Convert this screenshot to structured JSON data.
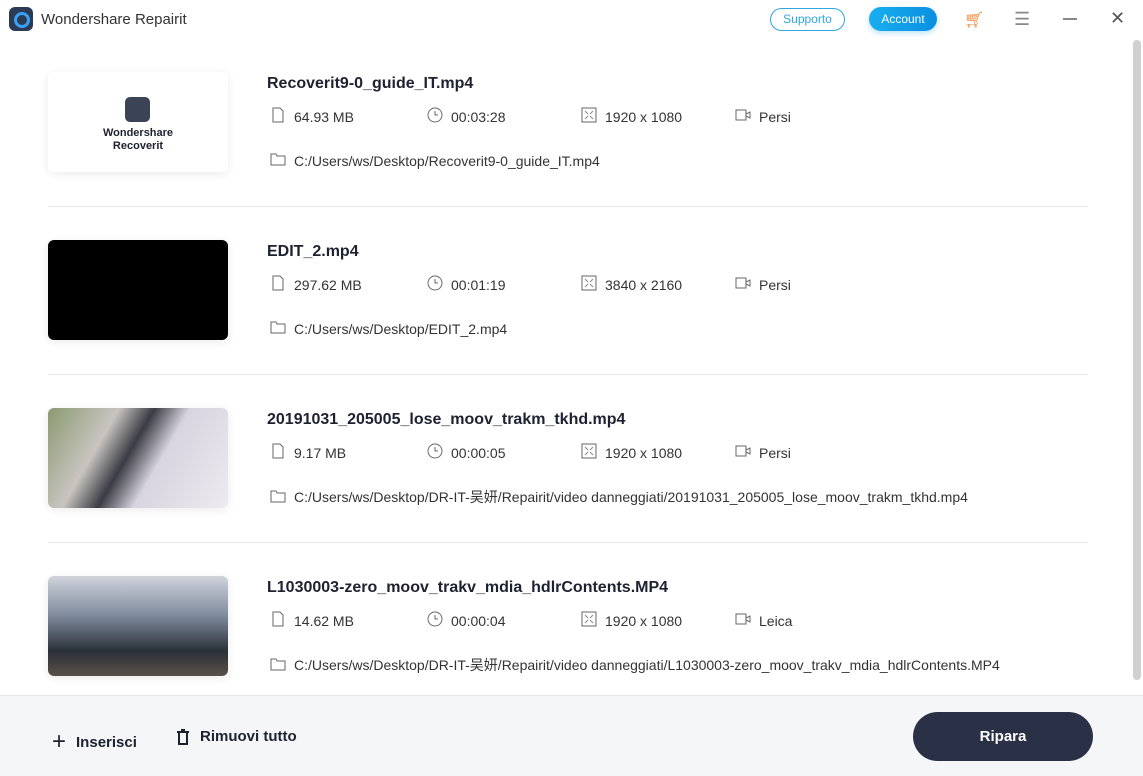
{
  "app": {
    "title": "Wondershare Repairit"
  },
  "header": {
    "support_label": "Supporto",
    "account_label": "Account",
    "accent": "#0b8fe0"
  },
  "files": [
    {
      "name": "Recoverit9-0_guide_IT.mp4",
      "size": "64.93  MB",
      "duration": "00:03:28",
      "resolution": "1920 x 1080",
      "camera": "Persi",
      "path": "C:/Users/ws/Desktop/Recoverit9-0_guide_IT.mp4",
      "thumb_logo": "Wondershare Recoverit"
    },
    {
      "name": "EDIT_2.mp4",
      "size": "297.62  MB",
      "duration": "00:01:19",
      "resolution": "3840 x 2160",
      "camera": "Persi",
      "path": "C:/Users/ws/Desktop/EDIT_2.mp4"
    },
    {
      "name": "20191031_205005_lose_moov_trakm_tkhd.mp4",
      "size": "9.17  MB",
      "duration": "00:00:05",
      "resolution": "1920 x 1080",
      "camera": "Persi",
      "path": "C:/Users/ws/Desktop/DR-IT-吴妍/Repairit/video danneggiati/20191031_205005_lose_moov_trakm_tkhd.mp4"
    },
    {
      "name": "L1030003-zero_moov_trakv_mdia_hdlrContents.MP4",
      "size": "14.62  MB",
      "duration": "00:00:04",
      "resolution": "1920 x 1080",
      "camera": "Leica",
      "path": "C:/Users/ws/Desktop/DR-IT-吴妍/Repairit/video danneggiati/L1030003-zero_moov_trakv_mdia_hdlrContents.MP4"
    }
  ],
  "footer": {
    "add_label": "Inserisci",
    "remove_all_label": "Rimuovi tutto",
    "repair_label": "Ripara"
  }
}
